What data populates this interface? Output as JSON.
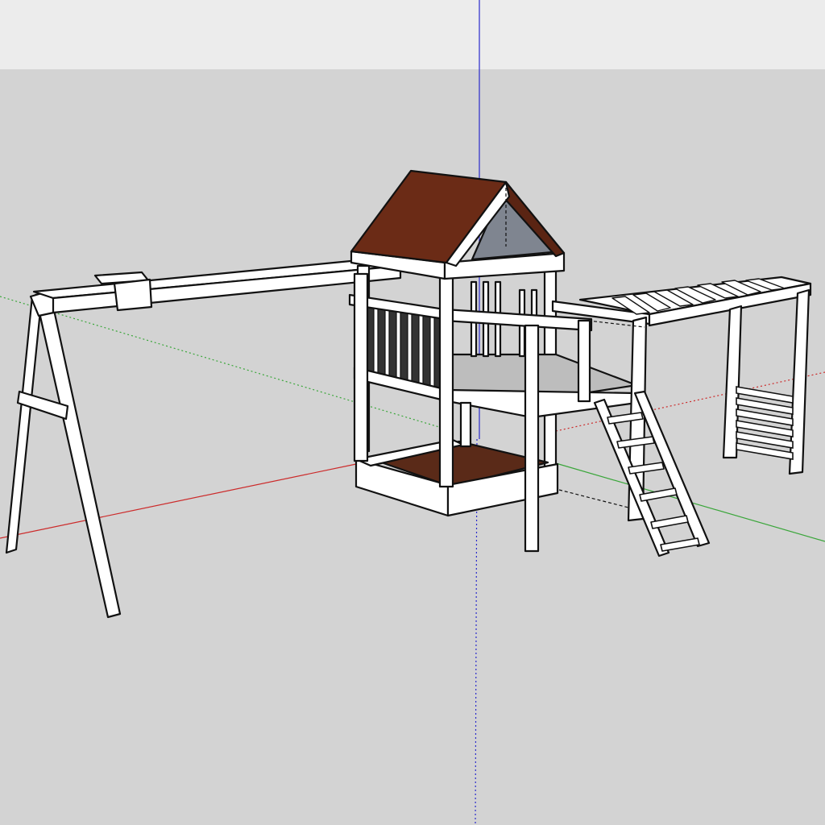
{
  "viewport": {
    "sky_color": "#ececec",
    "ground_color": "#d3d3d3"
  },
  "axes": {
    "red_axis_color": "#cc2a2a",
    "green_axis_color": "#3aa63a",
    "blue_axis_color": "#2a2acc"
  },
  "model": {
    "wood_color": "#ffffff",
    "edge_color": "#111111",
    "roof_color": "#6b2b16",
    "roof_shade_color": "#7f8590",
    "sandbox_color": "#5a2a18",
    "deck_shade_color": "#bdbdbd",
    "components": [
      {
        "name": "swing-beam"
      },
      {
        "name": "a-frame"
      },
      {
        "name": "fort"
      },
      {
        "name": "roof"
      },
      {
        "name": "sandbox"
      },
      {
        "name": "ladder"
      },
      {
        "name": "monkey-bars"
      },
      {
        "name": "climbing-wall"
      }
    ]
  }
}
